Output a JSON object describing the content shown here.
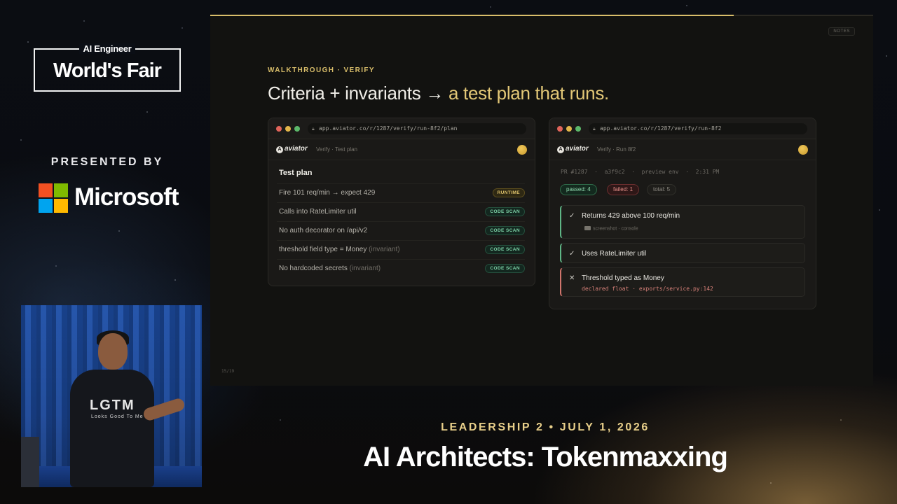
{
  "branding": {
    "top_label": "AI Engineer",
    "main_label": "World's Fair",
    "presented_by": "PRESENTED BY",
    "sponsor_name": "Microsoft",
    "sponsor_logo_colors": [
      "#f25022",
      "#7fba00",
      "#00a4ef",
      "#ffb900"
    ]
  },
  "speaker_video": {
    "shirt_text": "LGTM",
    "shirt_subtext": "Looks Good To Me"
  },
  "slide": {
    "notes_label": "NOTES",
    "progress_fraction": 0.79,
    "kicker": "WALKTHROUGH · VERIFY",
    "headline_plain": "Criteria + invariants → ",
    "headline_accent": "a test plan that runs.",
    "pager": "15/19",
    "accent_color": "#d8bd6a",
    "plan_window": {
      "url": "app.aviator.co/r/1287/verify/run-8f2/plan",
      "app_name": "aviator",
      "breadcrumb": "Verify · Test plan",
      "title": "Test plan",
      "rows": [
        {
          "text": "Fire 101 req/min → expect 429",
          "note": "",
          "tag": "RUNTIME",
          "kind": "runtime"
        },
        {
          "text": "Calls into RateLimiter util",
          "note": "",
          "tag": "CODE SCAN",
          "kind": "scan"
        },
        {
          "text": "No auth decorator on /api/v2",
          "note": "",
          "tag": "CODE SCAN",
          "kind": "scan"
        },
        {
          "text": "threshold field type = Money ",
          "note": "(invariant)",
          "tag": "CODE SCAN",
          "kind": "scan"
        },
        {
          "text": "No hardcoded secrets ",
          "note": "(invariant)",
          "tag": "CODE SCAN",
          "kind": "scan"
        }
      ]
    },
    "run_window": {
      "url": "app.aviator.co/r/1287/verify/run-8f2",
      "app_name": "aviator",
      "breadcrumb": "Verify · Run 8f2",
      "meta": "PR #1287  ·  a3f9c2  ·  preview env  ·  2:31 PM",
      "passed": "passed: 4",
      "failed": "failed: 1",
      "total": "total: 5",
      "checks": [
        {
          "status": "pass",
          "mark": "✓",
          "label": "Returns 429 above 100 req/min",
          "sub": "screenshot · console"
        },
        {
          "status": "pass",
          "mark": "✓",
          "label": "Uses RateLimiter util"
        },
        {
          "status": "fail",
          "mark": "✕",
          "label": "Threshold typed as Money",
          "error": "declared float · exports/service.py:142"
        }
      ]
    }
  },
  "footer": {
    "event": "LEADERSHIP 2 • JULY 1, 2026",
    "talk_title": "AI Architects: Tokenmaxxing"
  }
}
